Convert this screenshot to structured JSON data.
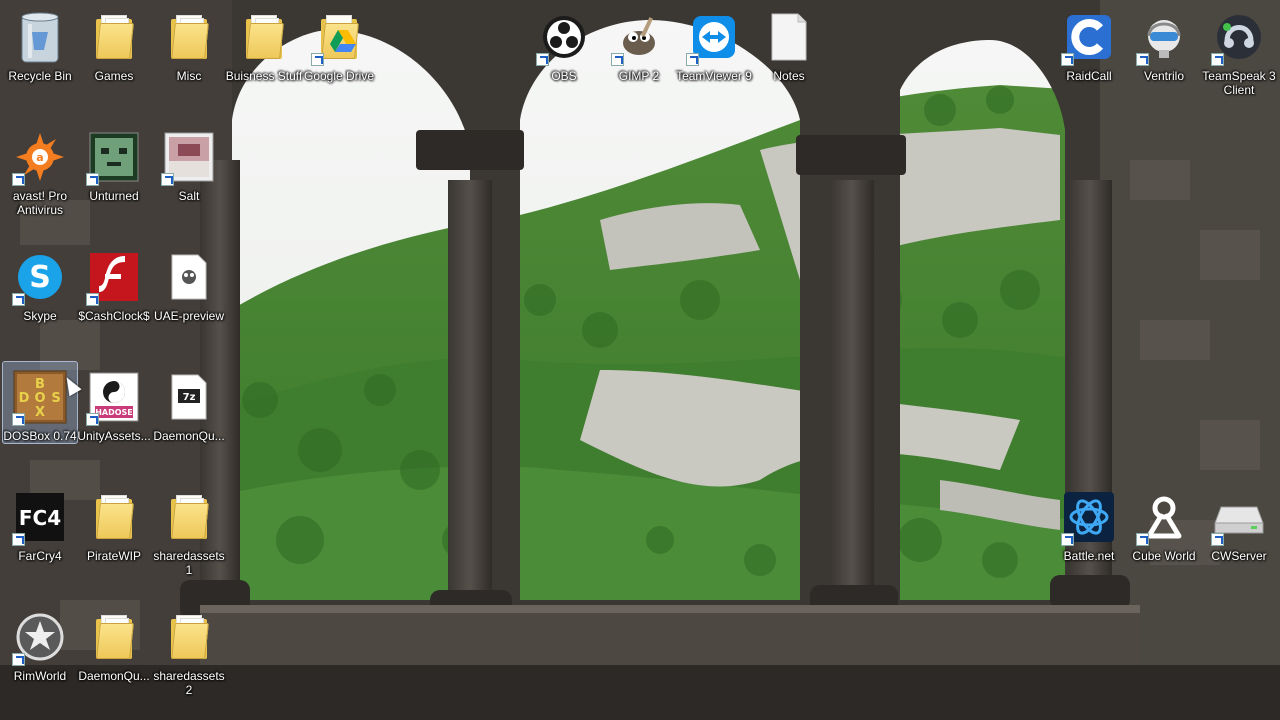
{
  "desktop": {
    "icons": [
      {
        "label": "Recycle Bin",
        "icon": "recycle-bin-icon"
      },
      {
        "label": "Games",
        "icon": "folder-icon"
      },
      {
        "label": "Misc",
        "icon": "folder-icon"
      },
      {
        "label": "Buisness Stuff",
        "icon": "folder-icon"
      },
      {
        "label": "Google Drive",
        "icon": "google-drive-folder-icon"
      },
      {
        "label": "OBS",
        "icon": "obs-icon"
      },
      {
        "label": "GIMP 2",
        "icon": "gimp-icon"
      },
      {
        "label": "TeamViewer 9",
        "icon": "teamviewer-icon"
      },
      {
        "label": "Notes",
        "icon": "text-file-icon"
      },
      {
        "label": "RaidCall",
        "icon": "raidcall-icon"
      },
      {
        "label": "Ventrilo",
        "icon": "ventrilo-icon"
      },
      {
        "label": "TeamSpeak 3 Client",
        "icon": "teamspeak-icon"
      },
      {
        "label": "avast! Pro Antivirus",
        "icon": "avast-icon"
      },
      {
        "label": "Unturned",
        "icon": "unturned-icon"
      },
      {
        "label": "Salt",
        "icon": "salt-icon"
      },
      {
        "label": "Skype",
        "icon": "skype-icon"
      },
      {
        "label": "$CashClock$",
        "icon": "flash-icon"
      },
      {
        "label": "UAE-preview",
        "icon": "uae-file-icon"
      },
      {
        "label": "DOSBox 0.74",
        "icon": "dosbox-icon"
      },
      {
        "label": "UnityAssets...",
        "icon": "unity-assets-icon"
      },
      {
        "label": "DaemonQu...",
        "icon": "7z-archive-icon"
      },
      {
        "label": "FarCry4",
        "icon": "farcry4-icon"
      },
      {
        "label": "PirateWIP",
        "icon": "folder-icon"
      },
      {
        "label": "sharedassets1",
        "icon": "folder-icon"
      },
      {
        "label": "Battle.net",
        "icon": "battlenet-icon"
      },
      {
        "label": "Cube World",
        "icon": "cube-world-icon"
      },
      {
        "label": "CWServer",
        "icon": "drive-icon"
      },
      {
        "label": "RimWorld",
        "icon": "rimworld-icon"
      },
      {
        "label": "DaemonQu...",
        "icon": "folder-icon"
      },
      {
        "label": "sharedassets2",
        "icon": "folder-icon"
      }
    ]
  },
  "dosbox_letters": [
    "B",
    "D",
    "O",
    "S",
    "X"
  ],
  "fc4_text": "FC4",
  "seven_z_text": "7z",
  "unity_label": "HADOSE",
  "colors": {
    "folder": "#eec759",
    "skype": "#1aa3e8",
    "flash": "#c4161c",
    "teamviewer": "#0e8ee9",
    "selection": "#a0bee6"
  }
}
